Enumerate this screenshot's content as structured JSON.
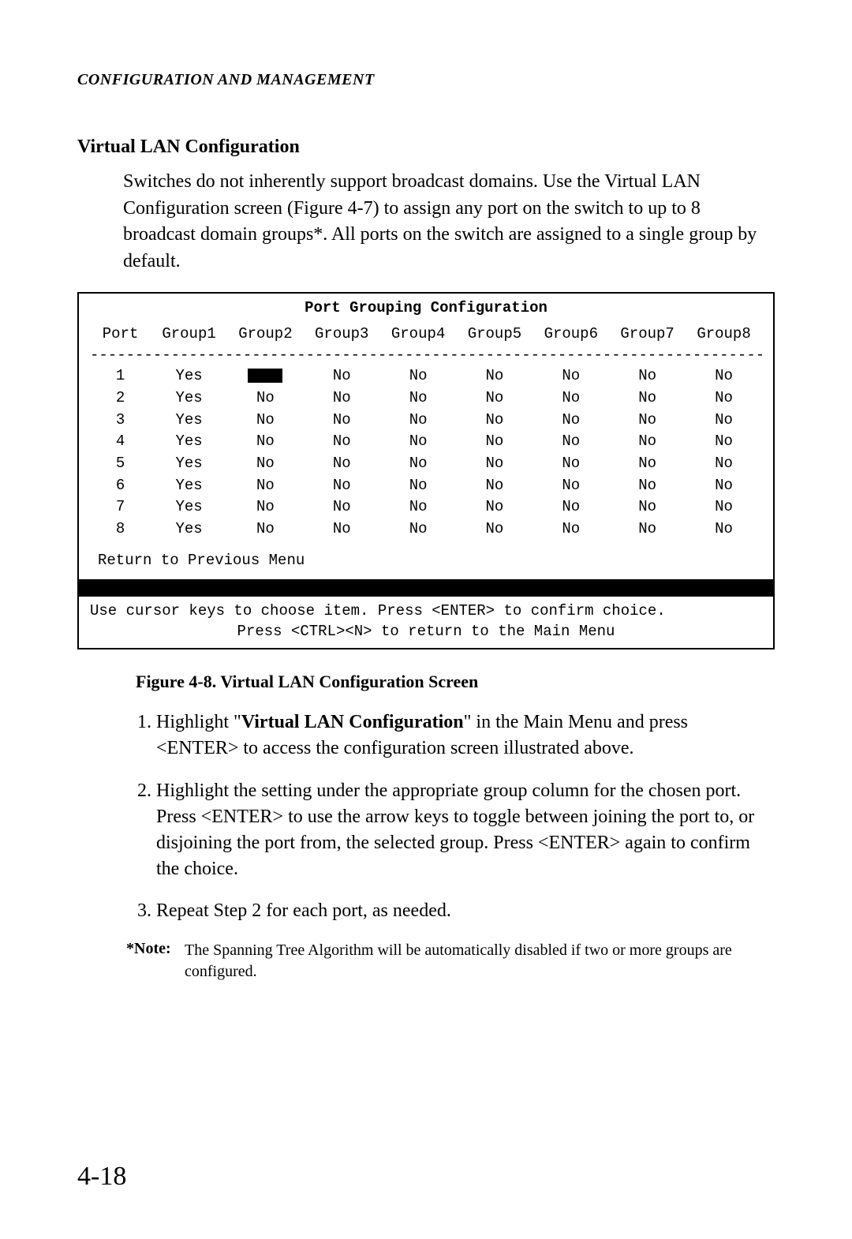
{
  "running_head": "CONFIGURATION AND MANAGEMENT",
  "section_title": "Virtual LAN Configuration",
  "intro": "Switches do not inherently support broadcast domains.  Use the Virtual LAN Configuration screen (Figure 4-7) to assign any port on the switch to up to 8 broadcast domain groups*.  All ports on the switch are assigned to a single group by default.",
  "terminal": {
    "title": "Port Grouping Configuration",
    "headers": [
      "Port",
      "Group1",
      "Group2",
      "Group3",
      "Group4",
      "Group5",
      "Group6",
      "Group7",
      "Group8"
    ],
    "dashes": "----------------------------------------------------------------------------",
    "rows": [
      {
        "port": "1",
        "g": [
          "Yes",
          "█",
          "No",
          "No",
          "No",
          "No",
          "No",
          "No"
        ]
      },
      {
        "port": "2",
        "g": [
          "Yes",
          "No",
          "No",
          "No",
          "No",
          "No",
          "No",
          "No"
        ]
      },
      {
        "port": "3",
        "g": [
          "Yes",
          "No",
          "No",
          "No",
          "No",
          "No",
          "No",
          "No"
        ]
      },
      {
        "port": "4",
        "g": [
          "Yes",
          "No",
          "No",
          "No",
          "No",
          "No",
          "No",
          "No"
        ]
      },
      {
        "port": "5",
        "g": [
          "Yes",
          "No",
          "No",
          "No",
          "No",
          "No",
          "No",
          "No"
        ]
      },
      {
        "port": "6",
        "g": [
          "Yes",
          "No",
          "No",
          "No",
          "No",
          "No",
          "No",
          "No"
        ]
      },
      {
        "port": "7",
        "g": [
          "Yes",
          "No",
          "No",
          "No",
          "No",
          "No",
          "No",
          "No"
        ]
      },
      {
        "port": "8",
        "g": [
          "Yes",
          "No",
          "No",
          "No",
          "No",
          "No",
          "No",
          "No"
        ]
      }
    ],
    "return_line": "Return to Previous Menu",
    "help1": "Use cursor keys to choose item.  Press <ENTER> to confirm choice.",
    "help2": "Press <CTRL><N> to return to the Main Menu"
  },
  "figure_caption": "Figure 4-8.  Virtual LAN Configuration Screen",
  "steps": {
    "s1_a": "Highlight \"",
    "s1_b": "Virtual LAN Configuration",
    "s1_c": "\" in the Main Menu and press <ENTER> to access the configuration screen illustrated above.",
    "s2": "Highlight the setting under the appropriate group column for the chosen port.  Press <ENTER> to use the arrow keys to toggle between joining the port to, or disjoining the port from, the selected group.  Press <ENTER> again to confirm the choice.",
    "s3": "Repeat Step 2 for each port, as needed."
  },
  "note": {
    "label": "*Note:",
    "body": "The Spanning Tree Algorithm will be automatically disabled if two or more groups are configured."
  },
  "page_number": "4-18"
}
